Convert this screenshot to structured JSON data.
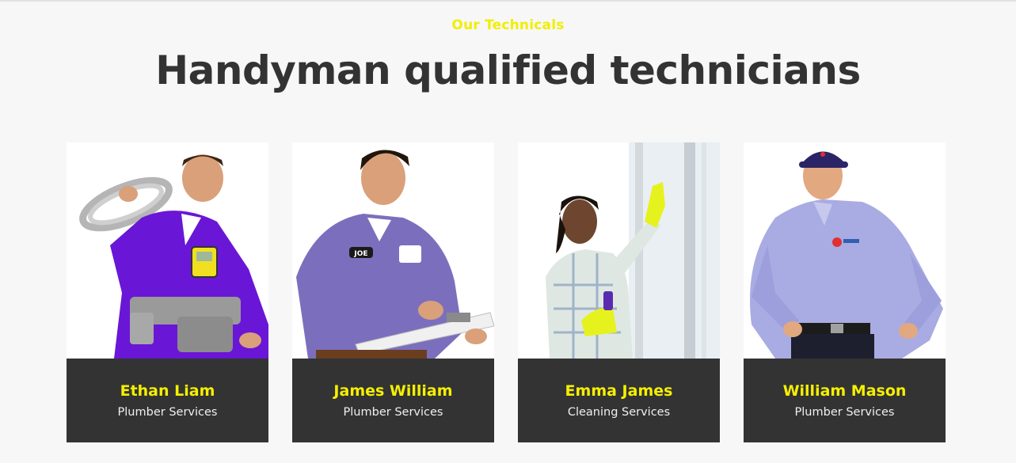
{
  "section": {
    "eyebrow": "Our Technicals",
    "title": "Handyman qualified technicians"
  },
  "technicians": [
    {
      "name": "Ethan Liam",
      "role": "Plumber Services",
      "badge": ""
    },
    {
      "name": "James William",
      "role": "Plumber Services",
      "badge": "JOE"
    },
    {
      "name": "Emma James",
      "role": "Cleaning Services",
      "badge": ""
    },
    {
      "name": "William Mason",
      "role": "Plumber Services",
      "badge": ""
    }
  ],
  "colors": {
    "accent": "#f5f000",
    "heading": "#333333",
    "caption_bg": "#333333",
    "background": "#f7f7f7"
  }
}
